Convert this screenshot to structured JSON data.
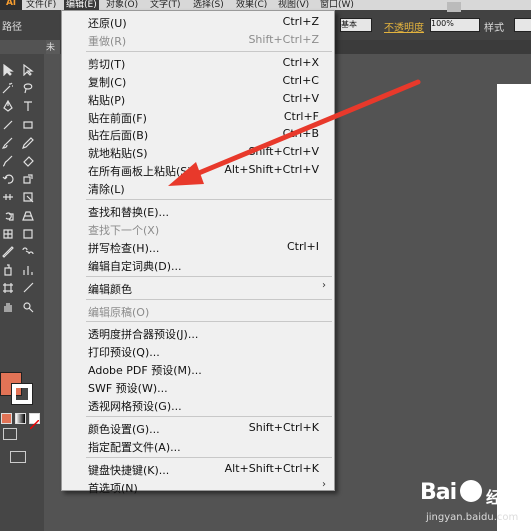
{
  "menubar": {
    "app_logo": "Ai",
    "items": [
      "文件(F)",
      "编辑(E)",
      "对象(O)",
      "文字(T)",
      "选择(S)",
      "效果(C)",
      "视图(V)",
      "窗口(W)"
    ]
  },
  "control_bar": {
    "path_label": "路径",
    "stroke_style": "基本",
    "opacity_label": "不透明度",
    "opacity_value": "100%",
    "style_label": "样式"
  },
  "document_tab": "未",
  "edit_menu": {
    "sections": [
      [
        {
          "label": "还原(U)",
          "shortcut": "Ctrl+Z",
          "enabled": true
        },
        {
          "label": "重做(R)",
          "shortcut": "Shift+Ctrl+Z",
          "enabled": false
        }
      ],
      [
        {
          "label": "剪切(T)",
          "shortcut": "Ctrl+X",
          "enabled": true
        },
        {
          "label": "复制(C)",
          "shortcut": "Ctrl+C",
          "enabled": true
        },
        {
          "label": "粘贴(P)",
          "shortcut": "Ctrl+V",
          "enabled": true
        },
        {
          "label": "贴在前面(F)",
          "shortcut": "Ctrl+F",
          "enabled": true
        },
        {
          "label": "贴在后面(B)",
          "shortcut": "Ctrl+B",
          "enabled": true
        },
        {
          "label": "就地粘贴(S)",
          "shortcut": "Shift+Ctrl+V",
          "enabled": true
        },
        {
          "label": "在所有画板上粘贴(S)",
          "shortcut": "Alt+Shift+Ctrl+V",
          "enabled": true
        },
        {
          "label": "清除(L)",
          "shortcut": "",
          "enabled": true
        }
      ],
      [
        {
          "label": "查找和替换(E)...",
          "shortcut": "",
          "enabled": true
        },
        {
          "label": "查找下一个(X)",
          "shortcut": "",
          "enabled": false
        },
        {
          "label": "拼写检查(H)...",
          "shortcut": "Ctrl+I",
          "enabled": true
        },
        {
          "label": "编辑自定词典(D)...",
          "shortcut": "",
          "enabled": true
        }
      ],
      [
        {
          "label": "编辑颜色",
          "shortcut": "",
          "enabled": true,
          "submenu": true
        }
      ],
      [
        {
          "label": "编辑原稿(O)",
          "shortcut": "",
          "enabled": false
        }
      ],
      [
        {
          "label": "透明度拼合器预设(J)...",
          "shortcut": "",
          "enabled": true
        },
        {
          "label": "打印预设(Q)...",
          "shortcut": "",
          "enabled": true
        },
        {
          "label": "Adobe PDF 预设(M)...",
          "shortcut": "",
          "enabled": true
        },
        {
          "label": "SWF 预设(W)...",
          "shortcut": "",
          "enabled": true
        },
        {
          "label": "透视网格预设(G)...",
          "shortcut": "",
          "enabled": true
        }
      ],
      [
        {
          "label": "颜色设置(G)...",
          "shortcut": "Shift+Ctrl+K",
          "enabled": true
        },
        {
          "label": "指定配置文件(A)...",
          "shortcut": "",
          "enabled": true
        }
      ],
      [
        {
          "label": "键盘快捷键(K)...",
          "shortcut": "Alt+Shift+Ctrl+K",
          "enabled": true
        },
        {
          "label": "首选项(N)",
          "shortcut": "",
          "enabled": true,
          "submenu": true
        }
      ]
    ]
  },
  "tools": [
    "selection-tool",
    "direct-selection-tool",
    "magic-wand-tool",
    "lasso-tool",
    "pen-tool",
    "type-tool",
    "line-tool",
    "rectangle-tool",
    "paintbrush-tool",
    "pencil-tool",
    "blob-brush-tool",
    "eraser-tool",
    "rotate-tool",
    "scale-tool",
    "width-tool",
    "free-transform-tool",
    "shape-builder-tool",
    "perspective-grid-tool",
    "mesh-tool",
    "gradient-tool",
    "eyedropper-tool",
    "blend-tool",
    "symbol-sprayer-tool",
    "column-graph-tool",
    "artboard-tool",
    "slice-tool",
    "hand-tool",
    "zoom-tool"
  ],
  "colors": {
    "fill": "#e27356",
    "stroke": "#ffffff",
    "menu_bg": "#f0f0f0",
    "arrow": "#e8392b",
    "opacity_link": "#e3b33e"
  },
  "watermark": {
    "brand": "Bai",
    "brand_cn": "经验",
    "url": "jingyan.baidu.com"
  }
}
